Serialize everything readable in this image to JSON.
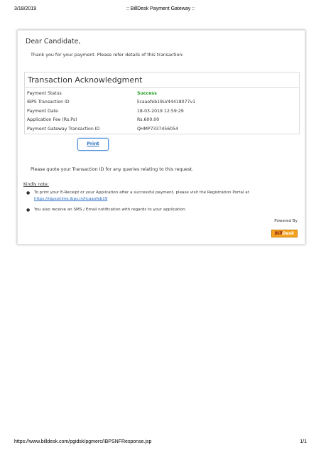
{
  "print_header": {
    "date": "3/18/2019",
    "title": ":: BillDesk Payment Gateway ::"
  },
  "print_footer": {
    "url": "https://www.billdesk.com/pgidsk/pgmerc/IBPSNFResponse.jsp",
    "page": "1/1"
  },
  "greeting": "Dear Candidate,",
  "thanks": "Thank you for your payment. Please refer details of this transaction:",
  "acknowledgment": {
    "title": "Transaction Acknowledgment",
    "rows": [
      {
        "label": "Payment Status",
        "value": "Success"
      },
      {
        "label": "IBPS Transaction ID",
        "value": "licaaofeb19LV44418077v1"
      },
      {
        "label": "Payment Date",
        "value": "18-03-2019 12:59:29"
      },
      {
        "label": "Application Fee (Rs.Ps)",
        "value": "Rs.600.00"
      },
      {
        "label": "Payment Gateway Transaction ID",
        "value": "QHMP7337456054"
      }
    ]
  },
  "print_button": "Print",
  "quote_note": "Please quote your Transaction ID for any queries relating to this request.",
  "kindly_note": {
    "heading": "Kindly note:",
    "item1_text": "To print your E-Receipt or your Application after a successful payment, please visit the Registration Portal at",
    "item1_link": "https://ibpsonline.ibps.in/licaaofeb19",
    "item2_text": "You also receive an SMS / Email notification with regards to your application."
  },
  "powered_by": {
    "label": "Powered By",
    "logo_b": "Bill",
    "logo_rest": "Desk"
  },
  "colors": {
    "success": "#1a9a1a",
    "link": "#2a6fc2",
    "logo_bg": "#f2a21e"
  }
}
